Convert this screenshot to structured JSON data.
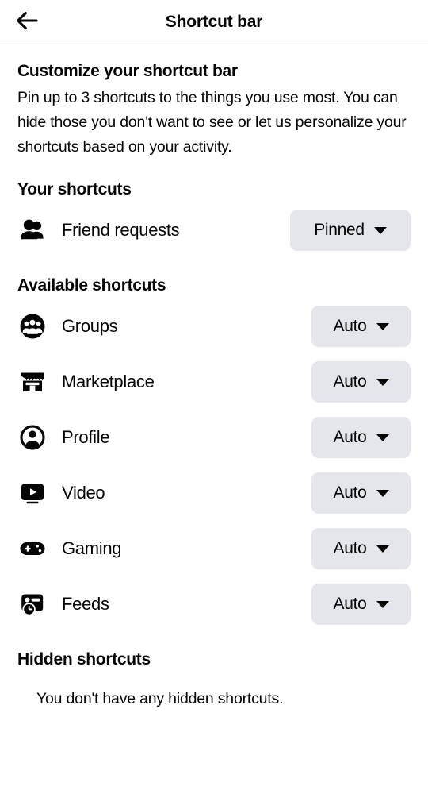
{
  "header": {
    "title": "Shortcut bar",
    "back_icon": "arrow-left-icon"
  },
  "intro": {
    "title": "Customize your shortcut bar",
    "body": "Pin up to 3 shortcuts to the things you use most. You can hide those you don't want to see or let us personalize your shortcuts based on your activity."
  },
  "your_shortcuts": {
    "title": "Your shortcuts",
    "items": [
      {
        "label": "Friend requests",
        "icon": "friends-icon",
        "status": "Pinned"
      }
    ]
  },
  "available_shortcuts": {
    "title": "Available shortcuts",
    "items": [
      {
        "label": "Groups",
        "icon": "groups-icon",
        "status": "Auto"
      },
      {
        "label": "Marketplace",
        "icon": "marketplace-icon",
        "status": "Auto"
      },
      {
        "label": "Profile",
        "icon": "profile-icon",
        "status": "Auto"
      },
      {
        "label": "Video",
        "icon": "video-icon",
        "status": "Auto"
      },
      {
        "label": "Gaming",
        "icon": "gaming-icon",
        "status": "Auto"
      },
      {
        "label": "Feeds",
        "icon": "feeds-icon",
        "status": "Auto"
      }
    ]
  },
  "hidden_shortcuts": {
    "title": "Hidden shortcuts",
    "empty_message": "You don't have any hidden shortcuts."
  },
  "colors": {
    "background": "#ffffff",
    "text": "#050505",
    "pill_background": "#e4e6eb",
    "divider": "#e4e6eb"
  }
}
